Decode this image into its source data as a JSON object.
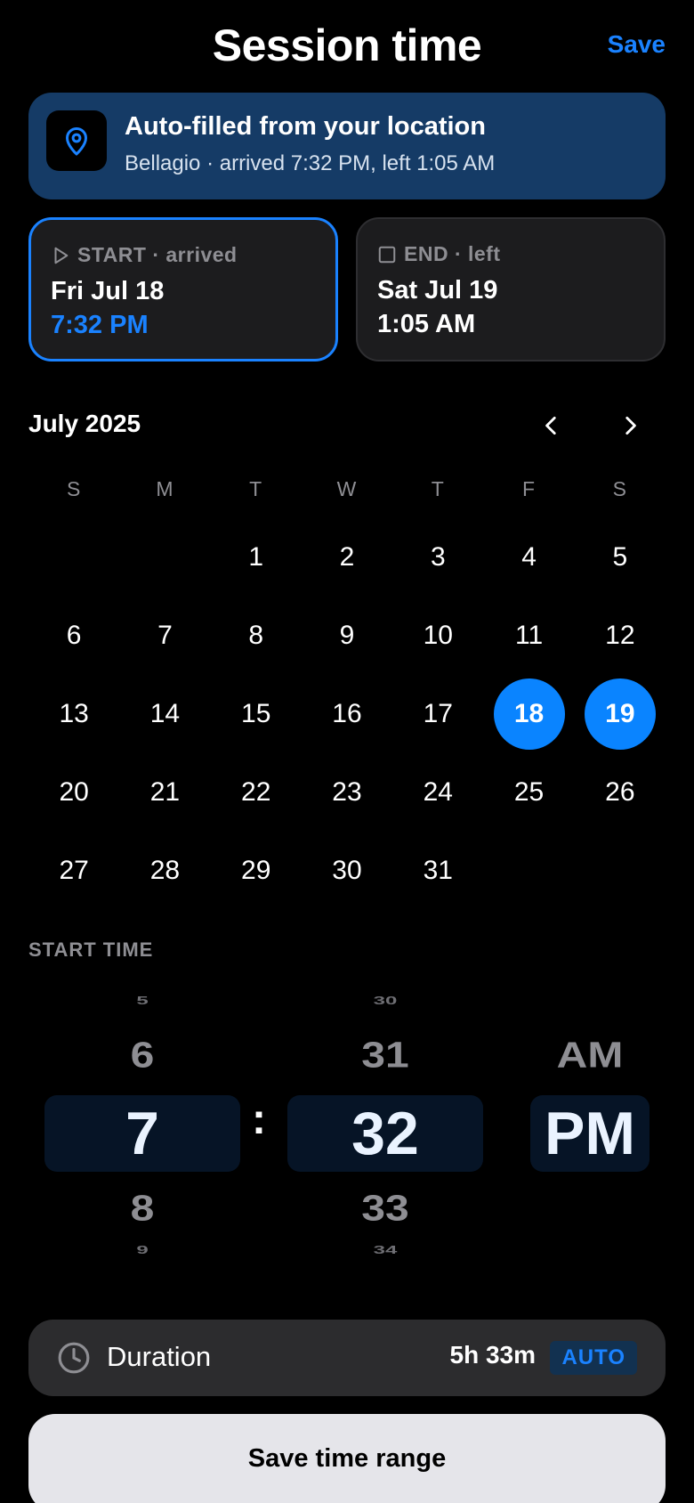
{
  "header": {
    "title": "Session time",
    "save_label": "Save"
  },
  "banner": {
    "title": "Auto-filled from your location",
    "subtitle": "Bellagio · arrived 7:32 PM, left 1:05 AM",
    "icon": "location-pin-icon"
  },
  "start_card": {
    "label": "START · arrived",
    "date": "Fri Jul 18",
    "time": "7:32 PM",
    "icon": "play-icon"
  },
  "end_card": {
    "label": "END · left",
    "date": "Sat Jul 19",
    "time": "1:05 AM",
    "icon": "stop-icon"
  },
  "calendar": {
    "month": "July 2025",
    "weekdays": [
      "S",
      "M",
      "T",
      "W",
      "T",
      "F",
      "S"
    ],
    "days": [
      "",
      "",
      "1",
      "2",
      "3",
      "4",
      "5",
      "6",
      "7",
      "8",
      "9",
      "10",
      "11",
      "12",
      "13",
      "14",
      "15",
      "16",
      "17",
      "18",
      "19",
      "20",
      "21",
      "22",
      "23",
      "24",
      "25",
      "26",
      "27",
      "28",
      "29",
      "30",
      "31",
      "",
      ""
    ],
    "selected": [
      "18",
      "19"
    ]
  },
  "start_time": {
    "label": "START TIME",
    "hour": {
      "far_above": "5",
      "above": "6",
      "selected": "7",
      "below": "8",
      "far_below": "9"
    },
    "minute": {
      "far_above": "30",
      "above": "31",
      "selected": "32",
      "below": "33",
      "far_below": "34"
    },
    "ampm": {
      "above": "AM",
      "selected": "PM"
    },
    "separator": ":"
  },
  "duration": {
    "label": "Duration",
    "value": "5h 33m",
    "badge": "AUTO",
    "icon": "clock-icon"
  },
  "save_button": {
    "label": "Save time range"
  },
  "colors": {
    "accent": "#0a84ff",
    "banner_bg": "#153b66",
    "card_bg": "#1c1c1e"
  }
}
